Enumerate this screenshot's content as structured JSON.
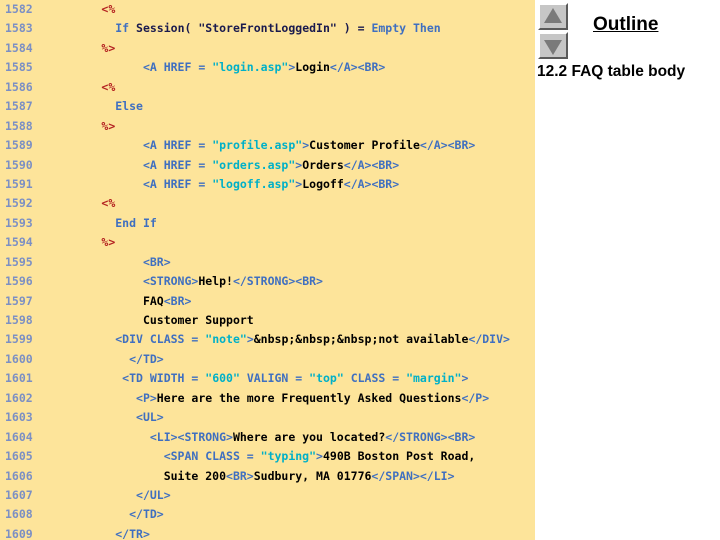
{
  "code_panel": {
    "background_color": "#fde49a",
    "line_number_color": "#7b8fc4",
    "lines": [
      {
        "no": "1582",
        "segments": [
          {
            "cls": "t-plain",
            "text": "        "
          },
          {
            "cls": "t-asp",
            "text": "<%"
          }
        ]
      },
      {
        "no": "1583",
        "segments": [
          {
            "cls": "t-plain",
            "text": "          "
          },
          {
            "cls": "t-kw",
            "text": "If"
          },
          {
            "cls": "t-plain",
            "text": " Session( \"StoreFrontLoggedIn\" ) = "
          },
          {
            "cls": "t-kw",
            "text": "Empty Then"
          }
        ]
      },
      {
        "no": "1584",
        "segments": [
          {
            "cls": "t-plain",
            "text": "        "
          },
          {
            "cls": "t-asp",
            "text": "%>"
          }
        ]
      },
      {
        "no": "1585",
        "segments": [
          {
            "cls": "t-plain",
            "text": "              "
          },
          {
            "cls": "t-tag",
            "text": "<A HREF = "
          },
          {
            "cls": "t-attrval",
            "text": "\"login.asp\""
          },
          {
            "cls": "t-tag",
            "text": ">"
          },
          {
            "cls": "t-text",
            "text": "Login"
          },
          {
            "cls": "t-tag",
            "text": "</A><BR>"
          }
        ]
      },
      {
        "no": "1586",
        "segments": [
          {
            "cls": "t-plain",
            "text": "        "
          },
          {
            "cls": "t-asp",
            "text": "<%"
          }
        ]
      },
      {
        "no": "1587",
        "segments": [
          {
            "cls": "t-plain",
            "text": "          "
          },
          {
            "cls": "t-kw",
            "text": "Else"
          }
        ]
      },
      {
        "no": "1588",
        "segments": [
          {
            "cls": "t-plain",
            "text": "        "
          },
          {
            "cls": "t-asp",
            "text": "%>"
          }
        ]
      },
      {
        "no": "1589",
        "segments": [
          {
            "cls": "t-plain",
            "text": "              "
          },
          {
            "cls": "t-tag",
            "text": "<A HREF = "
          },
          {
            "cls": "t-attrval",
            "text": "\"profile.asp\""
          },
          {
            "cls": "t-tag",
            "text": ">"
          },
          {
            "cls": "t-text",
            "text": "Customer Profile"
          },
          {
            "cls": "t-tag",
            "text": "</A><BR>"
          }
        ]
      },
      {
        "no": "1590",
        "segments": [
          {
            "cls": "t-plain",
            "text": "              "
          },
          {
            "cls": "t-tag",
            "text": "<A HREF = "
          },
          {
            "cls": "t-attrval",
            "text": "\"orders.asp\""
          },
          {
            "cls": "t-tag",
            "text": ">"
          },
          {
            "cls": "t-text",
            "text": "Orders"
          },
          {
            "cls": "t-tag",
            "text": "</A><BR>"
          }
        ]
      },
      {
        "no": "1591",
        "segments": [
          {
            "cls": "t-plain",
            "text": "              "
          },
          {
            "cls": "t-tag",
            "text": "<A HREF = "
          },
          {
            "cls": "t-attrval",
            "text": "\"logoff.asp\""
          },
          {
            "cls": "t-tag",
            "text": ">"
          },
          {
            "cls": "t-text",
            "text": "Logoff"
          },
          {
            "cls": "t-tag",
            "text": "</A><BR>"
          }
        ]
      },
      {
        "no": "1592",
        "segments": [
          {
            "cls": "t-plain",
            "text": "        "
          },
          {
            "cls": "t-asp",
            "text": "<%"
          }
        ]
      },
      {
        "no": "1593",
        "segments": [
          {
            "cls": "t-plain",
            "text": "          "
          },
          {
            "cls": "t-kw",
            "text": "End If"
          }
        ]
      },
      {
        "no": "1594",
        "segments": [
          {
            "cls": "t-plain",
            "text": "        "
          },
          {
            "cls": "t-asp",
            "text": "%>"
          }
        ]
      },
      {
        "no": "1595",
        "segments": [
          {
            "cls": "t-plain",
            "text": "              "
          },
          {
            "cls": "t-tag",
            "text": "<BR>"
          }
        ]
      },
      {
        "no": "1596",
        "segments": [
          {
            "cls": "t-plain",
            "text": "              "
          },
          {
            "cls": "t-tag",
            "text": "<STRONG>"
          },
          {
            "cls": "t-text",
            "text": "Help!"
          },
          {
            "cls": "t-tag",
            "text": "</STRONG><BR>"
          }
        ]
      },
      {
        "no": "1597",
        "segments": [
          {
            "cls": "t-plain",
            "text": "              "
          },
          {
            "cls": "t-text",
            "text": "FAQ"
          },
          {
            "cls": "t-tag",
            "text": "<BR>"
          }
        ]
      },
      {
        "no": "1598",
        "segments": [
          {
            "cls": "t-plain",
            "text": "              "
          },
          {
            "cls": "t-text",
            "text": "Customer Support"
          }
        ]
      },
      {
        "no": "1599",
        "segments": [
          {
            "cls": "t-plain",
            "text": "          "
          },
          {
            "cls": "t-tag",
            "text": "<DIV CLASS = "
          },
          {
            "cls": "t-attrval",
            "text": "\"note\""
          },
          {
            "cls": "t-tag",
            "text": ">"
          },
          {
            "cls": "t-text",
            "text": "&nbsp;&nbsp;&nbsp;not available"
          },
          {
            "cls": "t-tag",
            "text": "</DIV>"
          }
        ]
      },
      {
        "no": "1600",
        "segments": [
          {
            "cls": "t-plain",
            "text": "            "
          },
          {
            "cls": "t-tag",
            "text": "</TD>"
          }
        ]
      },
      {
        "no": "1601",
        "segments": [
          {
            "cls": "t-plain",
            "text": "           "
          },
          {
            "cls": "t-tag",
            "text": "<TD WIDTH = "
          },
          {
            "cls": "t-attrval",
            "text": "\"600\""
          },
          {
            "cls": "t-tag",
            "text": " VALIGN = "
          },
          {
            "cls": "t-attrval",
            "text": "\"top\""
          },
          {
            "cls": "t-tag",
            "text": " CLASS = "
          },
          {
            "cls": "t-attrval",
            "text": "\"margin\""
          },
          {
            "cls": "t-tag",
            "text": ">"
          }
        ]
      },
      {
        "no": "1602",
        "segments": [
          {
            "cls": "t-plain",
            "text": "             "
          },
          {
            "cls": "t-tag",
            "text": "<P>"
          },
          {
            "cls": "t-text",
            "text": "Here are the more Frequently Asked Questions"
          },
          {
            "cls": "t-tag",
            "text": "</P>"
          }
        ]
      },
      {
        "no": "1603",
        "segments": [
          {
            "cls": "t-plain",
            "text": "             "
          },
          {
            "cls": "t-tag",
            "text": "<UL>"
          }
        ]
      },
      {
        "no": "1604",
        "segments": [
          {
            "cls": "t-plain",
            "text": "               "
          },
          {
            "cls": "t-tag",
            "text": "<LI><STRONG>"
          },
          {
            "cls": "t-text",
            "text": "Where are you located?"
          },
          {
            "cls": "t-tag",
            "text": "</STRONG><BR>"
          }
        ]
      },
      {
        "no": "1605",
        "segments": [
          {
            "cls": "t-plain",
            "text": "                 "
          },
          {
            "cls": "t-tag",
            "text": "<SPAN CLASS = "
          },
          {
            "cls": "t-attrval",
            "text": "\"typing\""
          },
          {
            "cls": "t-tag",
            "text": ">"
          },
          {
            "cls": "t-text",
            "text": "490B Boston Post Road,"
          }
        ]
      },
      {
        "no": "1606",
        "segments": [
          {
            "cls": "t-plain",
            "text": "                 "
          },
          {
            "cls": "t-text",
            "text": "Suite 200"
          },
          {
            "cls": "t-tag",
            "text": "<BR>"
          },
          {
            "cls": "t-text",
            "text": "Sudbury, MA 01776"
          },
          {
            "cls": "t-tag",
            "text": "</SPAN></LI>"
          }
        ]
      },
      {
        "no": "1607",
        "segments": [
          {
            "cls": "t-plain",
            "text": "             "
          },
          {
            "cls": "t-tag",
            "text": "</UL>"
          }
        ]
      },
      {
        "no": "1608",
        "segments": [
          {
            "cls": "t-plain",
            "text": "            "
          },
          {
            "cls": "t-tag",
            "text": "</TD>"
          }
        ]
      },
      {
        "no": "1609",
        "segments": [
          {
            "cls": "t-plain",
            "text": "          "
          },
          {
            "cls": "t-tag",
            "text": "</TR>"
          }
        ]
      }
    ]
  },
  "outline": {
    "title": "Outline",
    "entry": "12.2 FAQ table body",
    "scroll_up_icon": "triangle-up-icon",
    "scroll_down_icon": "triangle-down-icon"
  }
}
